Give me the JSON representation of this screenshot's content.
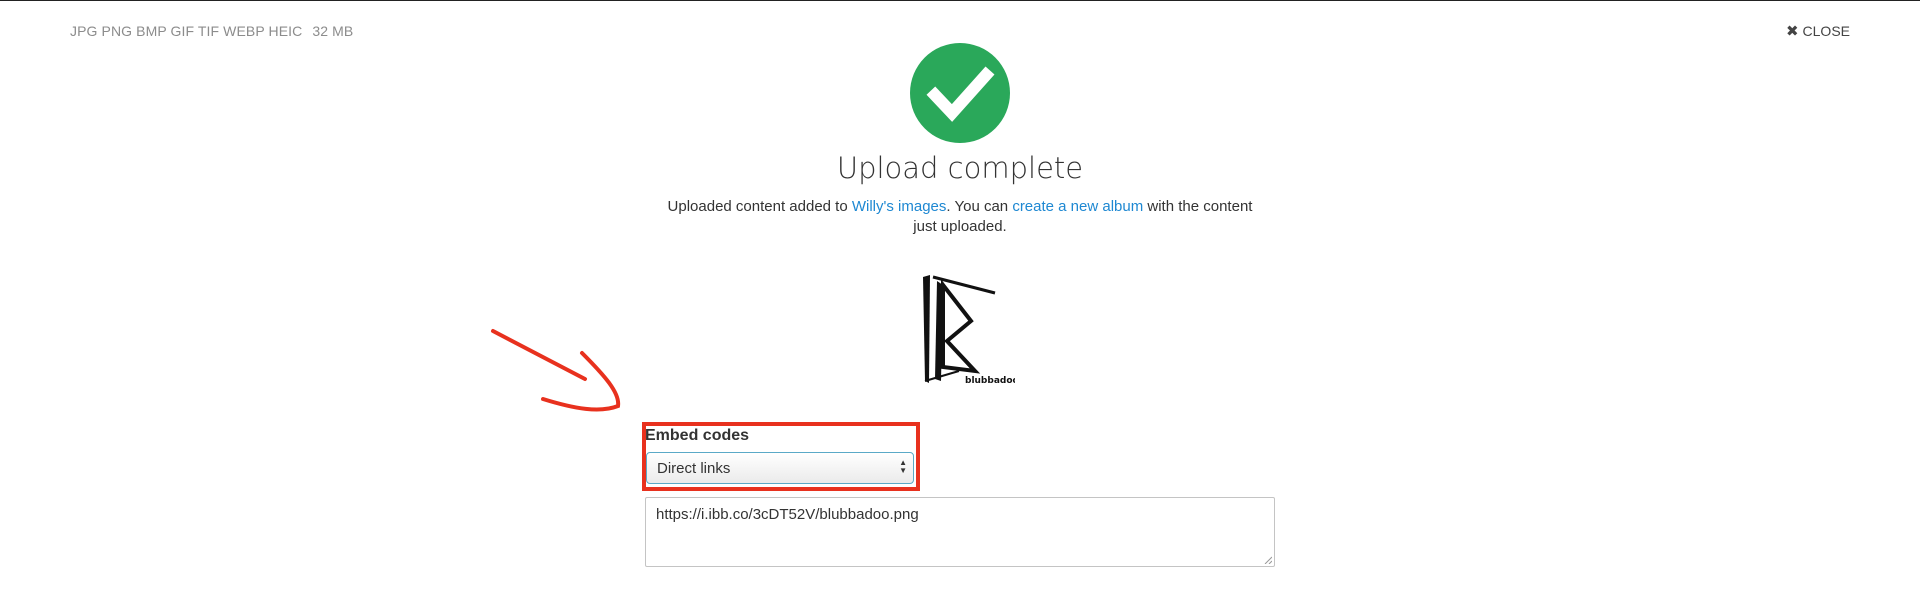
{
  "header": {
    "formats": "JPG PNG BMP GIF TIF WEBP HEIC",
    "max_size": "32 MB",
    "close_label": "CLOSE",
    "close_icon": "close-icon"
  },
  "status": {
    "icon": "check-circle-icon",
    "title": "Upload complete",
    "desc_prefix": "Uploaded content added to ",
    "album_link": "Willy's images",
    "desc_middle": ". You can ",
    "create_album_link": "create a new album",
    "desc_suffix": " with the content just uploaded."
  },
  "preview": {
    "caption": "blubbadoo"
  },
  "embed": {
    "label": "Embed codes",
    "selected_option": "Direct links",
    "code_value": "https://i.ibb.co/3cDT52V/blubbadoo.png"
  },
  "colors": {
    "success": "#2aa85a",
    "link": "#1e88d2",
    "annotation": "#e8311e"
  }
}
